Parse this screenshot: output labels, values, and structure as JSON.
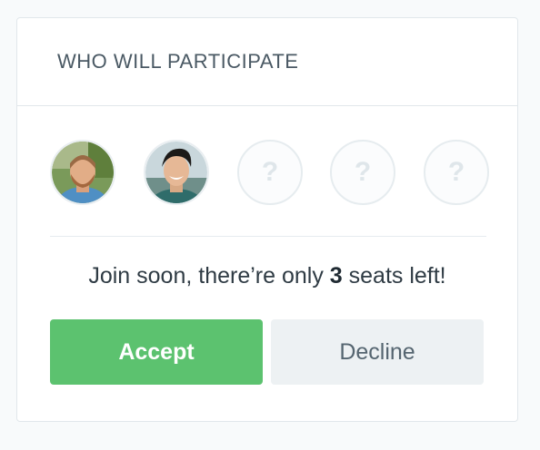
{
  "card": {
    "title": "WHO WILL PARTICIPATE"
  },
  "participants": [
    {
      "type": "photo",
      "name": "participant-1"
    },
    {
      "type": "photo",
      "name": "participant-2"
    },
    {
      "type": "empty",
      "placeholder": "?"
    },
    {
      "type": "empty",
      "placeholder": "?"
    },
    {
      "type": "empty",
      "placeholder": "?"
    }
  ],
  "seats": {
    "prefix": "Join soon, there’re only ",
    "count": "3",
    "suffix": " seats left!"
  },
  "actions": {
    "accept_label": "Accept",
    "decline_label": "Decline"
  },
  "colors": {
    "accept": "#5cc26f",
    "decline": "#edf1f3",
    "border": "#e1e7eb"
  }
}
